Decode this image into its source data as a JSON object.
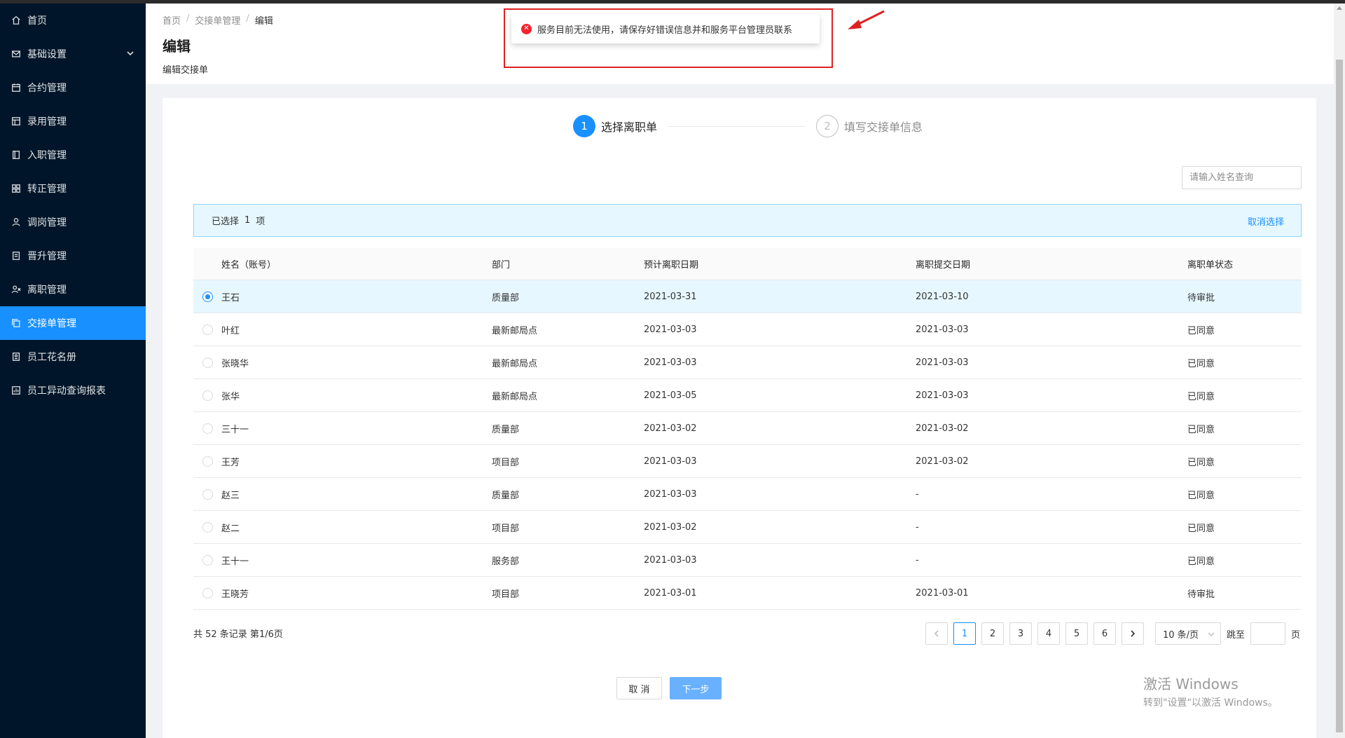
{
  "sidebar": {
    "items": [
      {
        "label": "首页",
        "icon": "home-icon"
      },
      {
        "label": "基础设置",
        "icon": "mail-icon",
        "expandable": true
      },
      {
        "label": "合约管理",
        "icon": "calendar-icon"
      },
      {
        "label": "录用管理",
        "icon": "table-icon"
      },
      {
        "label": "入职管理",
        "icon": "book-icon"
      },
      {
        "label": "转正管理",
        "icon": "grid-icon"
      },
      {
        "label": "调岗管理",
        "icon": "user-icon"
      },
      {
        "label": "晋升管理",
        "icon": "file-icon"
      },
      {
        "label": "离职管理",
        "icon": "user-leave-icon"
      },
      {
        "label": "交接单管理",
        "icon": "copy-icon",
        "active": true
      },
      {
        "label": "员工花名册",
        "icon": "roster-icon"
      },
      {
        "label": "员工异动查询报表",
        "icon": "report-icon"
      }
    ]
  },
  "header": {
    "breadcrumb": [
      "首页",
      "交接单管理",
      "编辑"
    ],
    "title": "编辑",
    "subtitle": "编辑交接单"
  },
  "error_message": {
    "text": "服务目前无法使用，请保存好错误信息并和服务平台管理员联系"
  },
  "steps": [
    {
      "num": "1",
      "label": "选择离职单",
      "active": true
    },
    {
      "num": "2",
      "label": "填写交接单信息",
      "active": false
    }
  ],
  "search": {
    "placeholder": "请输入姓名查询"
  },
  "selection": {
    "prefix": "已选择",
    "count": "1",
    "suffix": "项",
    "clear_label": "取消选择"
  },
  "table": {
    "columns": [
      "姓名（账号）",
      "部门",
      "预计离职日期",
      "离职提交日期",
      "离职单状态"
    ],
    "rows": [
      {
        "name": "王石",
        "dept": "质量部",
        "expected": "2021-03-31",
        "submitted": "2021-03-10",
        "status": "待审批",
        "selected": true
      },
      {
        "name": "叶红",
        "dept": "最新邮局点",
        "expected": "2021-03-03",
        "submitted": "2021-03-03",
        "status": "已同意",
        "selected": false
      },
      {
        "name": "张晓华",
        "dept": "最新邮局点",
        "expected": "2021-03-03",
        "submitted": "2021-03-03",
        "status": "已同意",
        "selected": false
      },
      {
        "name": "张华",
        "dept": "最新邮局点",
        "expected": "2021-03-05",
        "submitted": "2021-03-03",
        "status": "已同意",
        "selected": false
      },
      {
        "name": "三十一",
        "dept": "质量部",
        "expected": "2021-03-02",
        "submitted": "2021-03-02",
        "status": "已同意",
        "selected": false
      },
      {
        "name": "王芳",
        "dept": "项目部",
        "expected": "2021-03-03",
        "submitted": "2021-03-02",
        "status": "已同意",
        "selected": false
      },
      {
        "name": "赵三",
        "dept": "质量部",
        "expected": "2021-03-03",
        "submitted": "-",
        "status": "已同意",
        "selected": false
      },
      {
        "name": "赵二",
        "dept": "项目部",
        "expected": "2021-03-02",
        "submitted": "-",
        "status": "已同意",
        "selected": false
      },
      {
        "name": "王十一",
        "dept": "服务部",
        "expected": "2021-03-03",
        "submitted": "-",
        "status": "已同意",
        "selected": false
      },
      {
        "name": "王晓芳",
        "dept": "项目部",
        "expected": "2021-03-01",
        "submitted": "2021-03-01",
        "status": "待审批",
        "selected": false
      }
    ]
  },
  "pagination": {
    "total_text": "共 52 条记录 第1/6页",
    "pages": [
      "1",
      "2",
      "3",
      "4",
      "5",
      "6"
    ],
    "current": "1",
    "page_size": "10 条/页",
    "jump_label": "跳至",
    "page_label": "页"
  },
  "footer": {
    "cancel_label": "取 消",
    "next_label": "下一步"
  },
  "watermark": {
    "line1": "激活 Windows",
    "line2": "转到\"设置\"以激活 Windows。"
  },
  "colors": {
    "primary": "#1890ff",
    "sidebar_bg": "#001529",
    "error": "#f5222d",
    "annotation": "#e02020"
  }
}
